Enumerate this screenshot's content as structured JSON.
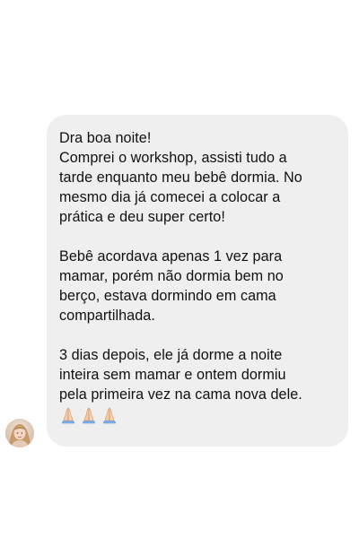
{
  "conversation": {
    "message": {
      "lines_p1": [
        "Dra boa noite!",
        "Comprei o workshop, assisti tudo a",
        "tarde enquanto meu bebê dormia. No",
        "mesmo dia já comecei a colocar a",
        "prática e deu super certo!"
      ],
      "lines_p2": [
        "Bebê acordava apenas 1 vez para",
        "mamar, porém não dormia bem no",
        "berço, estava dormindo em cama",
        "compartilhada."
      ],
      "lines_p3": [
        "3 dias depois, ele já dorme a noite",
        "inteira sem mamar e ontem dormiu",
        "pela primeira vez na cama nova dele."
      ],
      "emoji": "🙏🏻🙏🏻🙏🏻"
    },
    "bubble_color": "#efefef",
    "text_color": "#111111",
    "avatar_icon": "user-avatar-photo",
    "emoji_icon": "folded-hands-icon"
  }
}
